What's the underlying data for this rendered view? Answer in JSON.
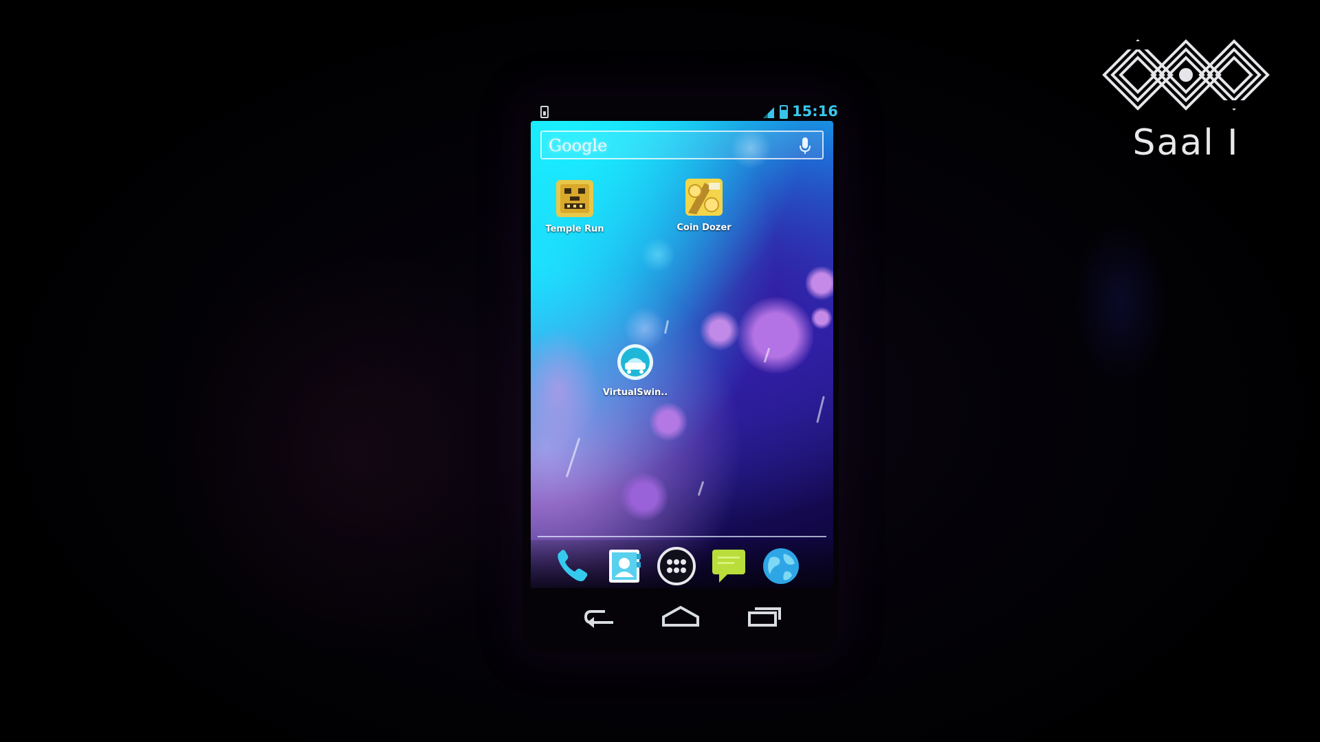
{
  "logo": {
    "label": "Saal I"
  },
  "status_bar": {
    "time": "15:16",
    "icons": [
      "sd-card-icon",
      "signal-icon",
      "battery-icon"
    ]
  },
  "search": {
    "brand": "Google",
    "icon": "mic-icon"
  },
  "home_apps": [
    {
      "label": "Temple Run",
      "icon": "temple-run-icon"
    },
    {
      "label": "Coin Dozer",
      "icon": "coin-dozer-icon"
    },
    {
      "label": "VirtualSwin..",
      "icon": "virtualswin-icon"
    }
  ],
  "dock": [
    {
      "name": "phone",
      "icon": "phone-icon"
    },
    {
      "name": "contacts",
      "icon": "contacts-icon"
    },
    {
      "name": "all-apps",
      "icon": "apps-grid-icon"
    },
    {
      "name": "messaging",
      "icon": "messaging-icon"
    },
    {
      "name": "browser",
      "icon": "globe-icon"
    }
  ],
  "nav": [
    {
      "name": "back",
      "icon": "back-icon"
    },
    {
      "name": "home",
      "icon": "home-icon"
    },
    {
      "name": "recents",
      "icon": "recents-icon"
    }
  ],
  "colors": {
    "clock": "#39c8ee",
    "wallpaper_top": "#12d0f0",
    "wallpaper_bottom": "#0a0630",
    "bokeh": "#b77be8"
  }
}
